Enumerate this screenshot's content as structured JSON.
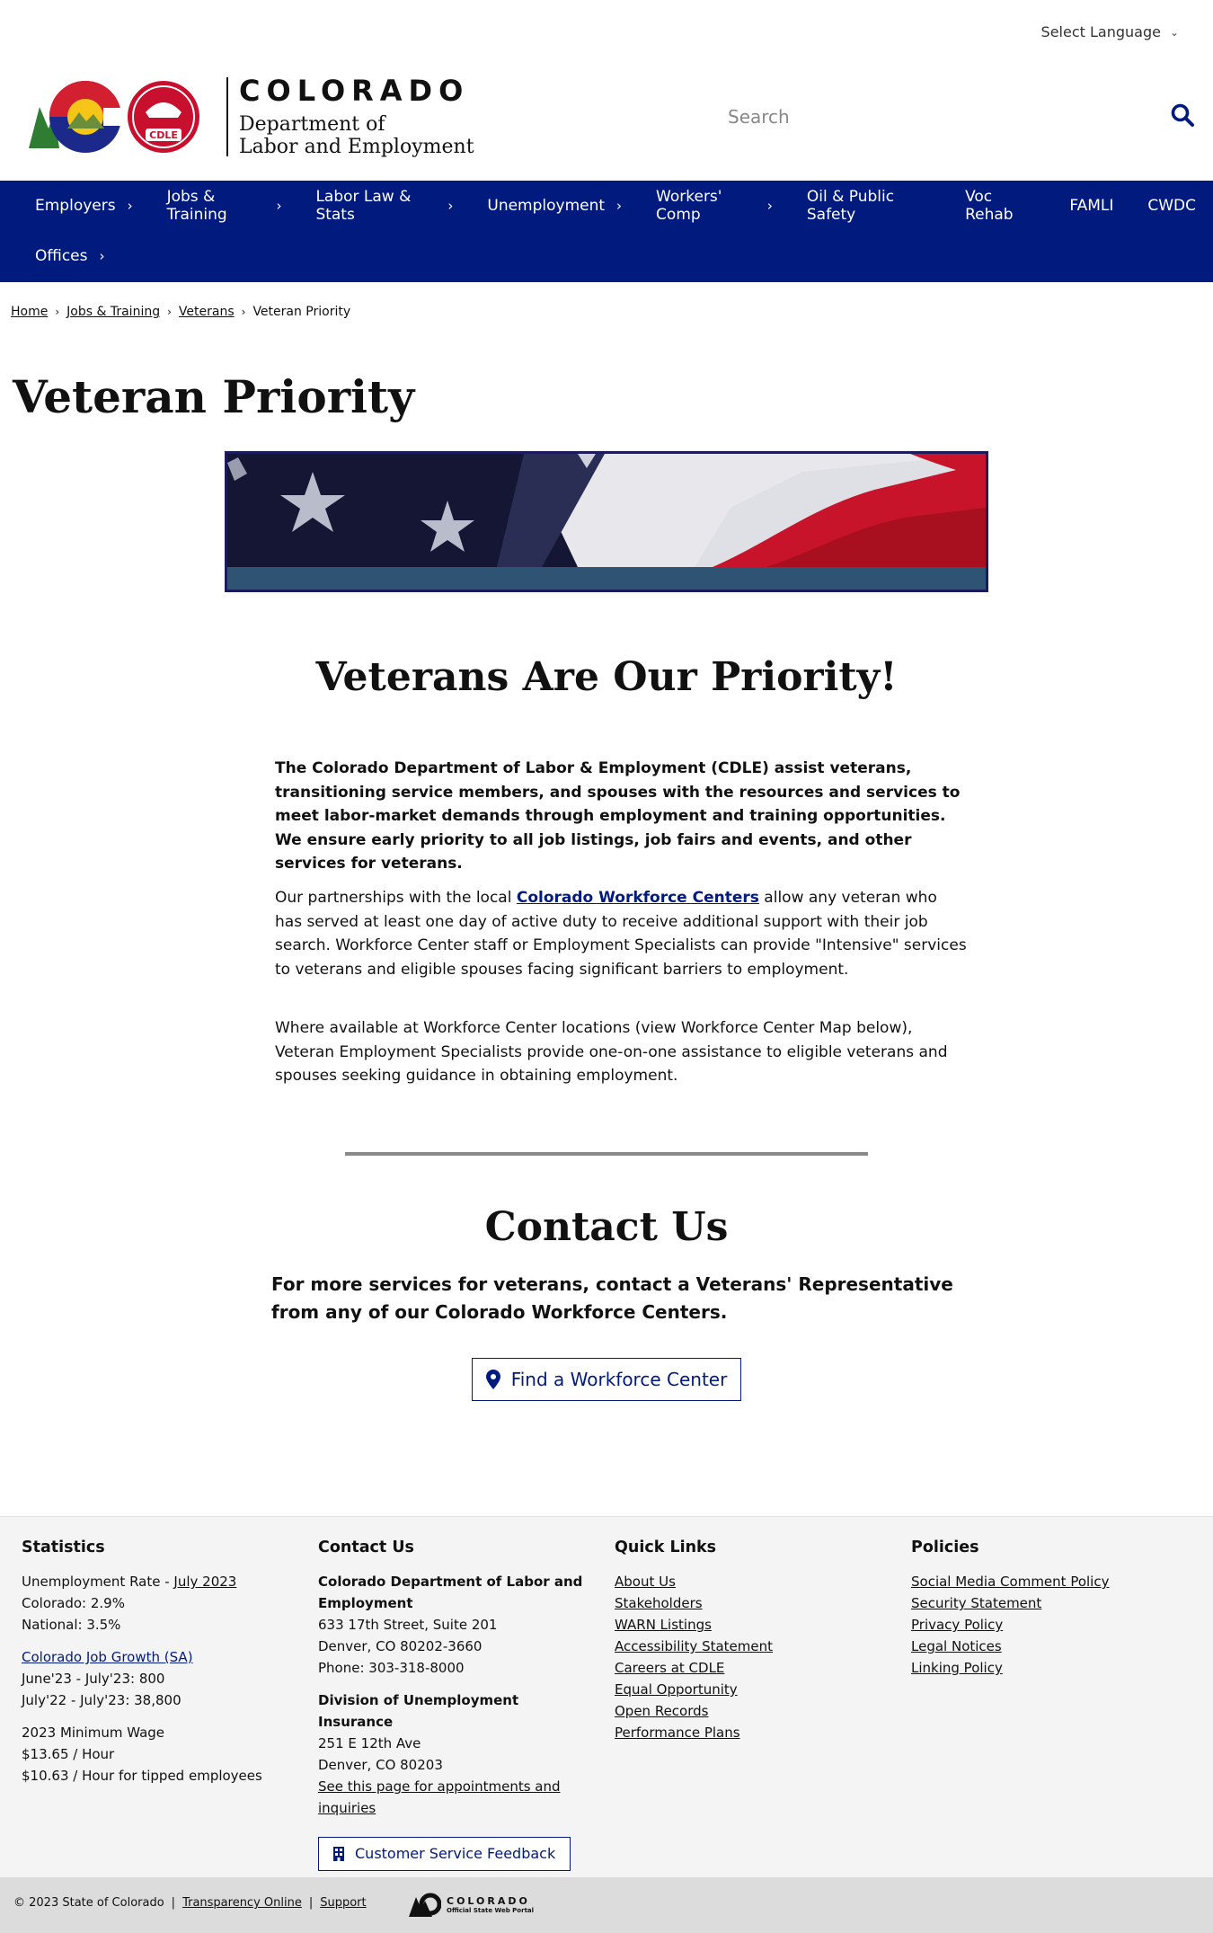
{
  "header": {
    "language_label": "Select Language",
    "logo": {
      "state": "COLORADO",
      "dept_line1": "Department of",
      "dept_line2": "Labor and Employment",
      "seal_text": "CDLE"
    },
    "search_placeholder": "Search"
  },
  "nav": {
    "items": [
      {
        "label": "Employers",
        "has_children": true
      },
      {
        "label": "Jobs & Training",
        "has_children": true
      },
      {
        "label": "Labor Law & Stats",
        "has_children": true
      },
      {
        "label": "Unemployment",
        "has_children": true
      },
      {
        "label": "Workers' Comp",
        "has_children": true
      },
      {
        "label": "Oil & Public Safety",
        "has_children": false
      },
      {
        "label": "Voc Rehab",
        "has_children": false
      },
      {
        "label": "FAMLI",
        "has_children": false
      },
      {
        "label": "CWDC",
        "has_children": false
      },
      {
        "label": "Offices",
        "has_children": true
      }
    ]
  },
  "breadcrumb": {
    "items": [
      "Home",
      "Jobs & Training",
      "Veterans"
    ],
    "current": "Veteran Priority"
  },
  "page": {
    "title": "Veteran Priority",
    "section_title": "Veterans Are Our Priority!",
    "intro": "The Colorado Department of Labor & Employment (CDLE) assist veterans, transitioning service members, and spouses with the resources and services to meet labor-market demands through employment and training opportunities. We ensure early priority to all job listings, job fairs and events, and other services for veterans.",
    "para2_before": "Our partnerships with the local ",
    "para2_link": "Colorado Workforce Centers",
    "para2_after": " allow any veteran who has served at least one day of active duty to receive additional support with their job search. Workforce Center staff or Employment Specialists can provide \"Intensive\" services to veterans and eligible spouses facing significant barriers to employment.",
    "para3": "Where available at Workforce Center locations (view Workforce Center Map below), Veteran Employment Specialists provide one-on-one assistance to eligible veterans and spouses seeking guidance in obtaining employment.",
    "contact_title": "Contact Us",
    "contact_lead": "For more services for veterans, contact a Veterans' Representative from any of our Colorado Workforce Centers.",
    "contact_button": "Find a Workforce Center"
  },
  "footer": {
    "statistics": {
      "heading": "Statistics",
      "unemployment_prefix": "Unemployment Rate - ",
      "unemployment_link": "July 2023",
      "colorado": "Colorado: 2.9%",
      "national": "National: 3.5%",
      "job_growth_link": "Colorado Job Growth (SA)",
      "growth_1": "June'23 - July'23: 800",
      "growth_2": "July'22 - July'23: 38,800",
      "min_wage_heading": "2023 Minimum Wage",
      "min_wage_1": "$13.65 / Hour",
      "min_wage_2": "$10.63 / Hour for tipped employees"
    },
    "contact": {
      "heading": "Contact Us",
      "org": "Colorado Department of Labor and Employment",
      "addr1": "633 17th Street, Suite 201",
      "addr2": "Denver, CO  80202-3660",
      "phone": "Phone: 303-318-8000",
      "ui_heading": "Division of Unemployment Insurance",
      "ui_addr1": "251 E 12th Ave",
      "ui_addr2": "Denver, CO  80203",
      "ui_link": "See this page for appointments and inquiries",
      "feedback_button": "Customer Service Feedback"
    },
    "quick_links": {
      "heading": "Quick Links",
      "items": [
        "About Us",
        "Stakeholders",
        "WARN Listings",
        "Accessibility Statement",
        "Careers at CDLE",
        "Equal Opportunity",
        "Open Records",
        "Performance Plans"
      ]
    },
    "policies": {
      "heading": "Policies",
      "items": [
        "Social Media Comment Policy",
        "Security Statement",
        "Privacy Policy",
        "Legal Notices",
        "Linking Policy"
      ]
    }
  },
  "bottom": {
    "copyright": "© 2023 State of Colorado",
    "transparency": "Transparency Online",
    "support": "Support",
    "portal_line1": "COLORADO",
    "portal_line2": "Official State Web Portal"
  },
  "colors": {
    "nav_bg": "#011a7e",
    "link": "#011a7e",
    "footer_bg": "#f4f4f4",
    "bottom_bg": "#dcdcdc"
  }
}
